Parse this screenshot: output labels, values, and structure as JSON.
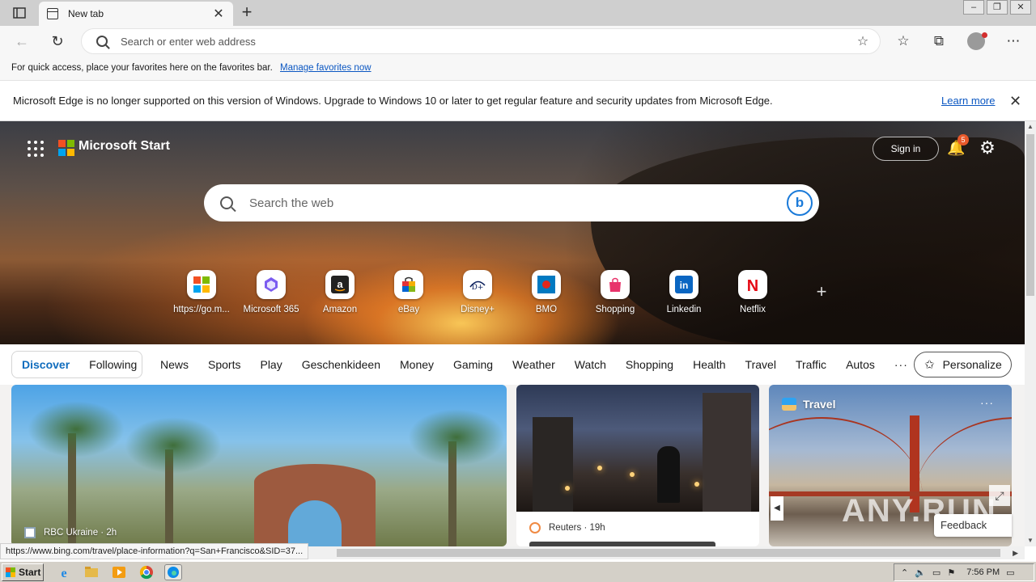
{
  "browser": {
    "tab_title": "New tab",
    "address_placeholder": "Search or enter web address"
  },
  "favorites_bar": {
    "message": "For quick access, place your favorites here on the favorites bar.",
    "link": "Manage favorites now"
  },
  "infobar": {
    "message": "Microsoft Edge is no longer supported on this version of Windows. Upgrade to Windows 10 or later to get regular feature and security updates from Microsoft Edge.",
    "link": "Learn more"
  },
  "header": {
    "brand": "Microsoft Start",
    "sign_in": "Sign in",
    "notification_count": "5"
  },
  "search": {
    "placeholder": "Search the web"
  },
  "quick_links": [
    {
      "label": "https://go.m...",
      "icon": "microsoft-logo"
    },
    {
      "label": "Microsoft 365",
      "icon": "m365-logo"
    },
    {
      "label": "Amazon",
      "icon": "amazon-logo"
    },
    {
      "label": "eBay",
      "icon": "ebay-bag"
    },
    {
      "label": "Disney+",
      "icon": "disney-logo"
    },
    {
      "label": "BMO",
      "icon": "bmo-logo"
    },
    {
      "label": "Shopping",
      "icon": "shopping-bag"
    },
    {
      "label": "Linkedin",
      "icon": "linkedin-logo"
    },
    {
      "label": "Netflix",
      "icon": "netflix-logo"
    }
  ],
  "feed_nav": {
    "segments": [
      "Discover",
      "Following"
    ],
    "categories": [
      "News",
      "Sports",
      "Play",
      "Geschenkideen",
      "Money",
      "Gaming",
      "Weather",
      "Watch",
      "Shopping",
      "Health",
      "Travel",
      "Traffic",
      "Autos"
    ],
    "more": "···",
    "personalize": "Personalize"
  },
  "cards": {
    "card1": {
      "source": "RBC Ukraine · 2h"
    },
    "card2": {
      "source": "Reuters · 19h"
    },
    "card3": {
      "category": "Travel",
      "more": "···"
    }
  },
  "feedback": "Feedback",
  "watermark": "ANY.RUN",
  "status_url": "https://www.bing.com/travel/place-information?q=San+Francisco&SID=37...",
  "taskbar": {
    "start": "Start",
    "clock": "7:56 PM"
  },
  "colors": {
    "link_blue": "#0b57c2",
    "accent": "#0f6cbd",
    "badge": "#e8592b"
  }
}
